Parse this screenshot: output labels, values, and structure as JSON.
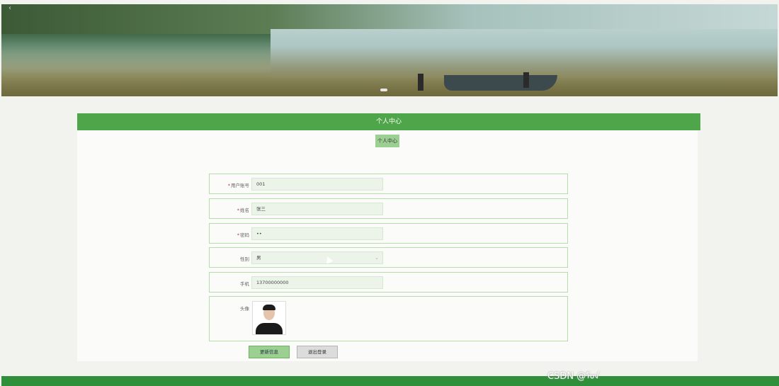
{
  "banner": {
    "prev_arrow": "‹",
    "next_arrow": "›"
  },
  "section": {
    "title": "个人中心"
  },
  "tabs": [
    {
      "label": "个人中心"
    }
  ],
  "form": {
    "fields": [
      {
        "label": "用户账号",
        "required": true,
        "value": "001"
      },
      {
        "label": "姓名",
        "required": true,
        "value": "张三"
      },
      {
        "label": "密码",
        "required": true,
        "value": "••"
      },
      {
        "label": "性别",
        "required": false,
        "value": "男"
      },
      {
        "label": "手机",
        "required": false,
        "value": "13700000000"
      }
    ],
    "avatar_label": "头像",
    "required_mark": "*",
    "select_caret": "⌄"
  },
  "buttons": {
    "update": "更新信息",
    "logout": "退出登录"
  },
  "watermark": "CSDN @ᠮᡨ"
}
